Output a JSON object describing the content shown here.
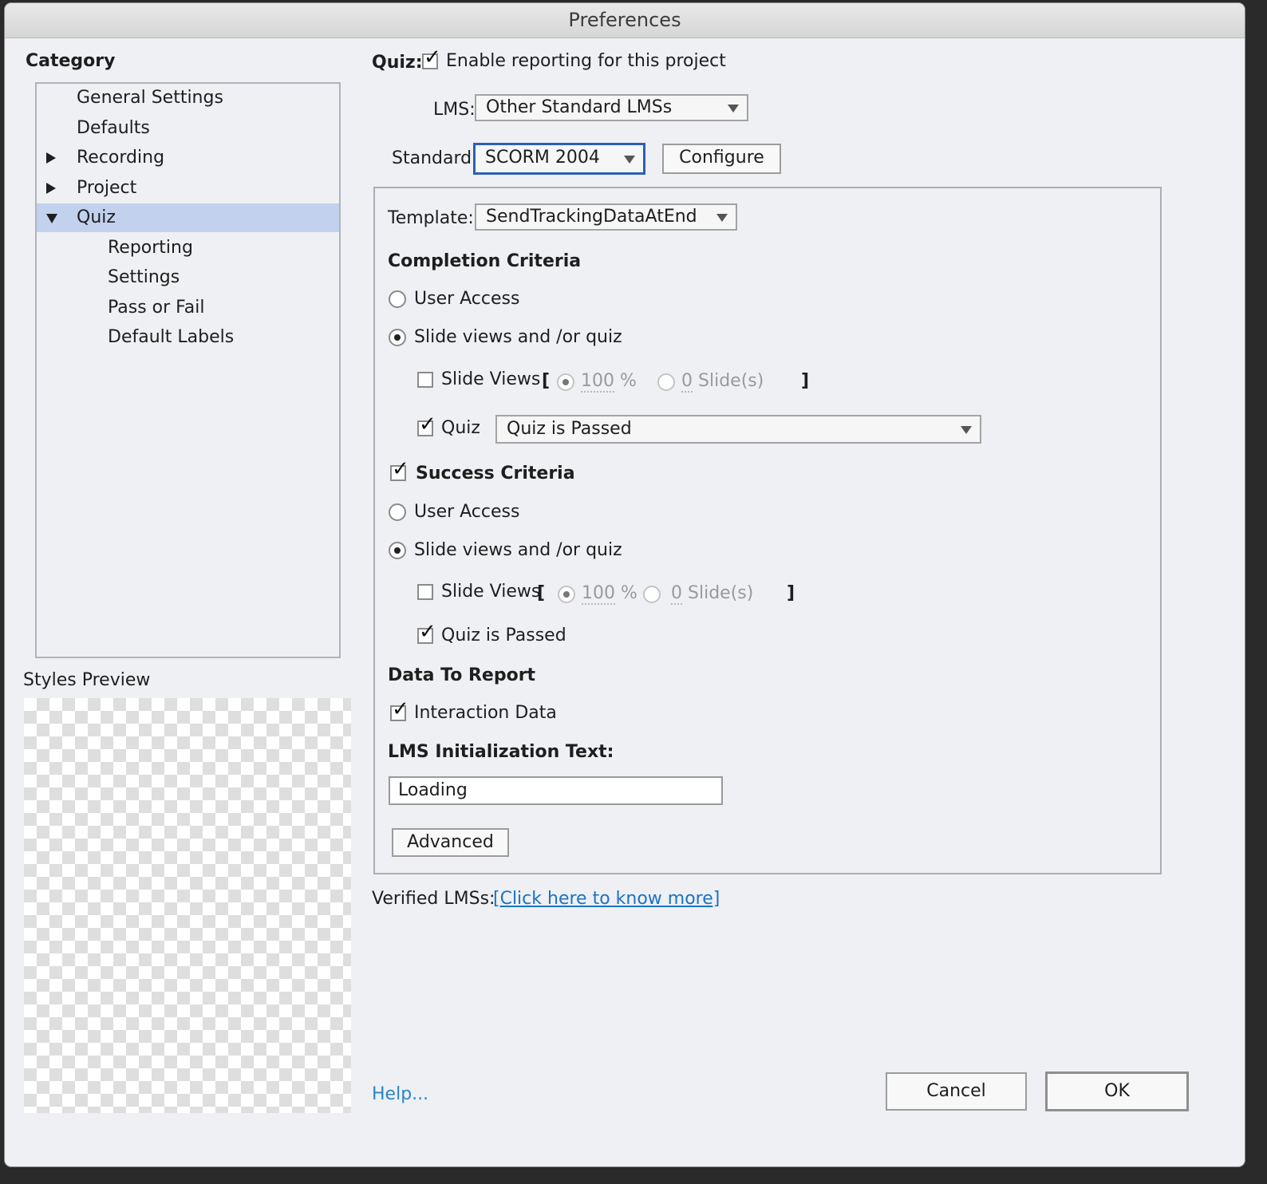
{
  "window": {
    "title": "Preferences"
  },
  "category": {
    "heading": "Category",
    "items": [
      {
        "label": "General Settings"
      },
      {
        "label": "Defaults"
      },
      {
        "label": "Recording"
      },
      {
        "label": "Project"
      },
      {
        "label": "Quiz"
      },
      {
        "label": "Reporting"
      },
      {
        "label": "Settings"
      },
      {
        "label": "Pass or Fail"
      },
      {
        "label": "Default Labels"
      }
    ],
    "selected": "Quiz"
  },
  "styles_preview": {
    "label": "Styles Preview"
  },
  "quiz": {
    "label": "Quiz:",
    "enable_reporting": {
      "label": "Enable reporting for this project",
      "checked": true
    }
  },
  "lms": {
    "label": "LMS:",
    "value": "Other Standard LMSs"
  },
  "standard": {
    "label": "Standard:",
    "value": "SCORM 2004",
    "configure_label": "Configure"
  },
  "template": {
    "label": "Template:",
    "value": "SendTrackingDataAtEnd"
  },
  "completion": {
    "heading": "Completion Criteria",
    "user_access": {
      "label": "User Access",
      "selected": false
    },
    "slide_views_quiz": {
      "label": "Slide views and /or quiz",
      "selected": true
    },
    "slide_views": {
      "label": "Slide Views",
      "bracket_open": "[",
      "bracket_close": "]",
      "checked": false,
      "percent_value": "100",
      "percent_unit": "%",
      "slides_value": "0",
      "slides_unit": "Slide(s)"
    },
    "quiz": {
      "label": "Quiz",
      "checked": true,
      "value": "Quiz is Passed"
    }
  },
  "success": {
    "heading": "Success Criteria",
    "checked": true,
    "user_access": {
      "label": "User Access",
      "selected": false
    },
    "slide_views_quiz": {
      "label": "Slide views and /or quiz",
      "selected": true
    },
    "slide_views": {
      "label": "Slide Views",
      "bracket_open": "[",
      "bracket_close": "]",
      "checked": false,
      "percent_value": "100",
      "percent_unit": "%",
      "slides_value": "0",
      "slides_unit": "Slide(s)"
    },
    "quiz_passed": {
      "label": "Quiz is Passed",
      "checked": true
    }
  },
  "data_to_report": {
    "heading": "Data To Report",
    "interaction_data": {
      "label": "Interaction Data",
      "checked": true
    }
  },
  "lms_init": {
    "label": "LMS Initialization Text:",
    "value": "Loading"
  },
  "advanced_label": "Advanced",
  "verified": {
    "label": "Verified LMSs:",
    "link": "[Click here to know more]"
  },
  "footer": {
    "help": "Help...",
    "cancel": "Cancel",
    "ok": "OK"
  },
  "colors": {
    "selection": "#c2d2ee",
    "focus_border": "#2b5fb8",
    "link": "#1a73c8",
    "dialog_bg": "#eff0f3"
  }
}
